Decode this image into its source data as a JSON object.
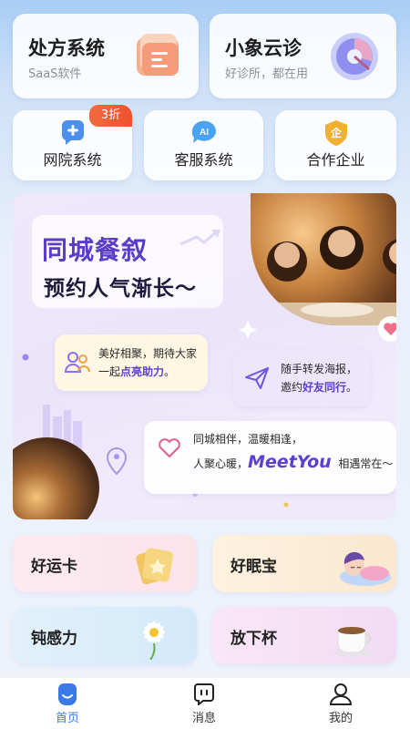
{
  "top_cards": {
    "prescription": {
      "title": "处方系统",
      "subtitle": "SaaS软件"
    },
    "clinic": {
      "title": "小象云诊",
      "subtitle": "好诊所，都在用"
    }
  },
  "quick_actions": {
    "web_hospital": {
      "label": "网院系统",
      "badge": "3折"
    },
    "customer_service": {
      "label": "客服系统",
      "icon_text": "AI"
    },
    "partner": {
      "label": "合作企业",
      "icon_text": "企"
    }
  },
  "banner": {
    "title_line1": "同城餐叙",
    "title_line2": "预约人气渐长～",
    "bubble1_line1": "美好相聚，期待大家",
    "bubble1_line2_pre": "一起",
    "bubble1_line2_hl": "点亮助力",
    "bubble1_line2_post": "。",
    "bubble2_line1": "随手转发海报，",
    "bubble2_line2_pre": "邀约",
    "bubble2_line2_hl": "好友同行",
    "bubble2_line2_post": "。",
    "bubble3_line1": "同城相伴，温暖相逢，",
    "bubble3_line2_pre": "人聚心暖，",
    "bubble3_brand": "MeetYou",
    "bubble3_line2_post": "相遇常在～"
  },
  "features": [
    {
      "label": "好运卡",
      "icon": "lucky-card-icon"
    },
    {
      "label": "好眠宝",
      "icon": "sleep-icon"
    },
    {
      "label": "钝感力",
      "icon": "daisy-icon"
    },
    {
      "label": "放下杯",
      "icon": "coffee-cup-icon"
    }
  ],
  "tabs": {
    "home": "首页",
    "messages": "消息",
    "me": "我的"
  },
  "colors": {
    "accent": "#3a7ae8",
    "badge": "#f0512c",
    "banner_purple": "#5a3cc8"
  }
}
